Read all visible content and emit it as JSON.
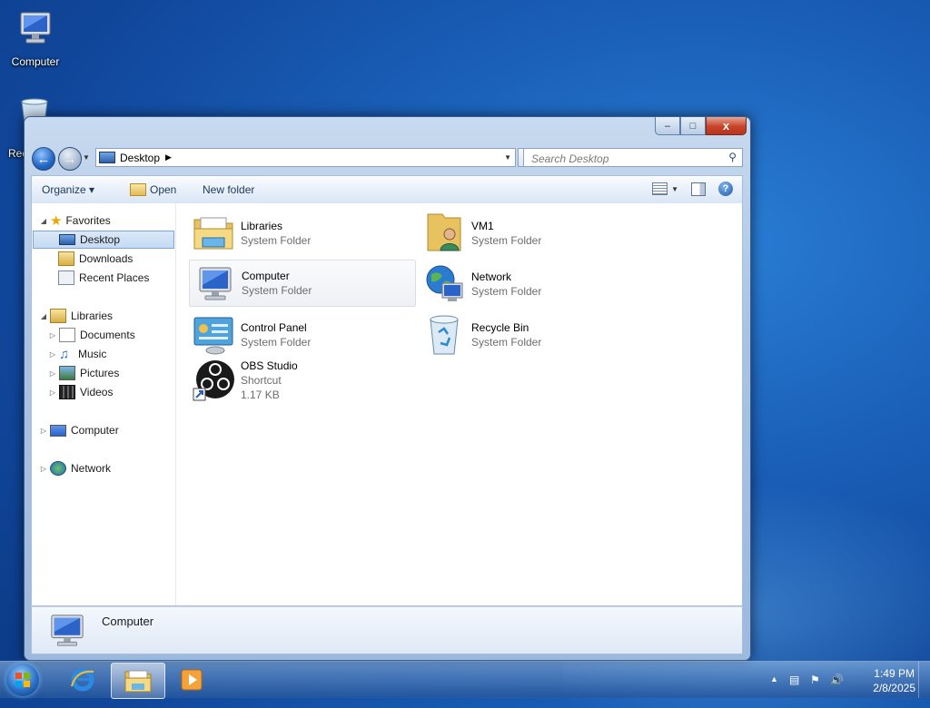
{
  "desktop": {
    "icons": [
      {
        "label": "Computer"
      },
      {
        "label": "Rec"
      }
    ]
  },
  "window": {
    "caption_buttons": {
      "minimize": "–",
      "maximize": "□",
      "close": "x"
    },
    "address": {
      "path": "Desktop"
    },
    "search": {
      "placeholder": "Search Desktop"
    },
    "toolbar": {
      "organize": "Organize ▾",
      "open": "Open",
      "new_folder": "New folder"
    },
    "nav_pane": {
      "favorites": {
        "label": "Favorites",
        "items": [
          "Desktop",
          "Downloads",
          "Recent Places"
        ]
      },
      "libraries": {
        "label": "Libraries",
        "items": [
          "Documents",
          "Music",
          "Pictures",
          "Videos"
        ]
      },
      "computer": "Computer",
      "network": "Network"
    },
    "items": [
      {
        "name": "Libraries",
        "type": "System Folder"
      },
      {
        "name": "VM1",
        "type": "System Folder"
      },
      {
        "name": "Computer",
        "type": "System Folder"
      },
      {
        "name": "Network",
        "type": "System Folder"
      },
      {
        "name": "Control Panel",
        "type": "System Folder"
      },
      {
        "name": "Recycle Bin",
        "type": "System Folder"
      },
      {
        "name": "OBS Studio",
        "type": "Shortcut",
        "size": "1.17 KB"
      }
    ],
    "details": {
      "selected": "Computer"
    }
  },
  "taskbar": {
    "clock": {
      "time": "1:49 PM",
      "date": "2/8/2025"
    }
  }
}
